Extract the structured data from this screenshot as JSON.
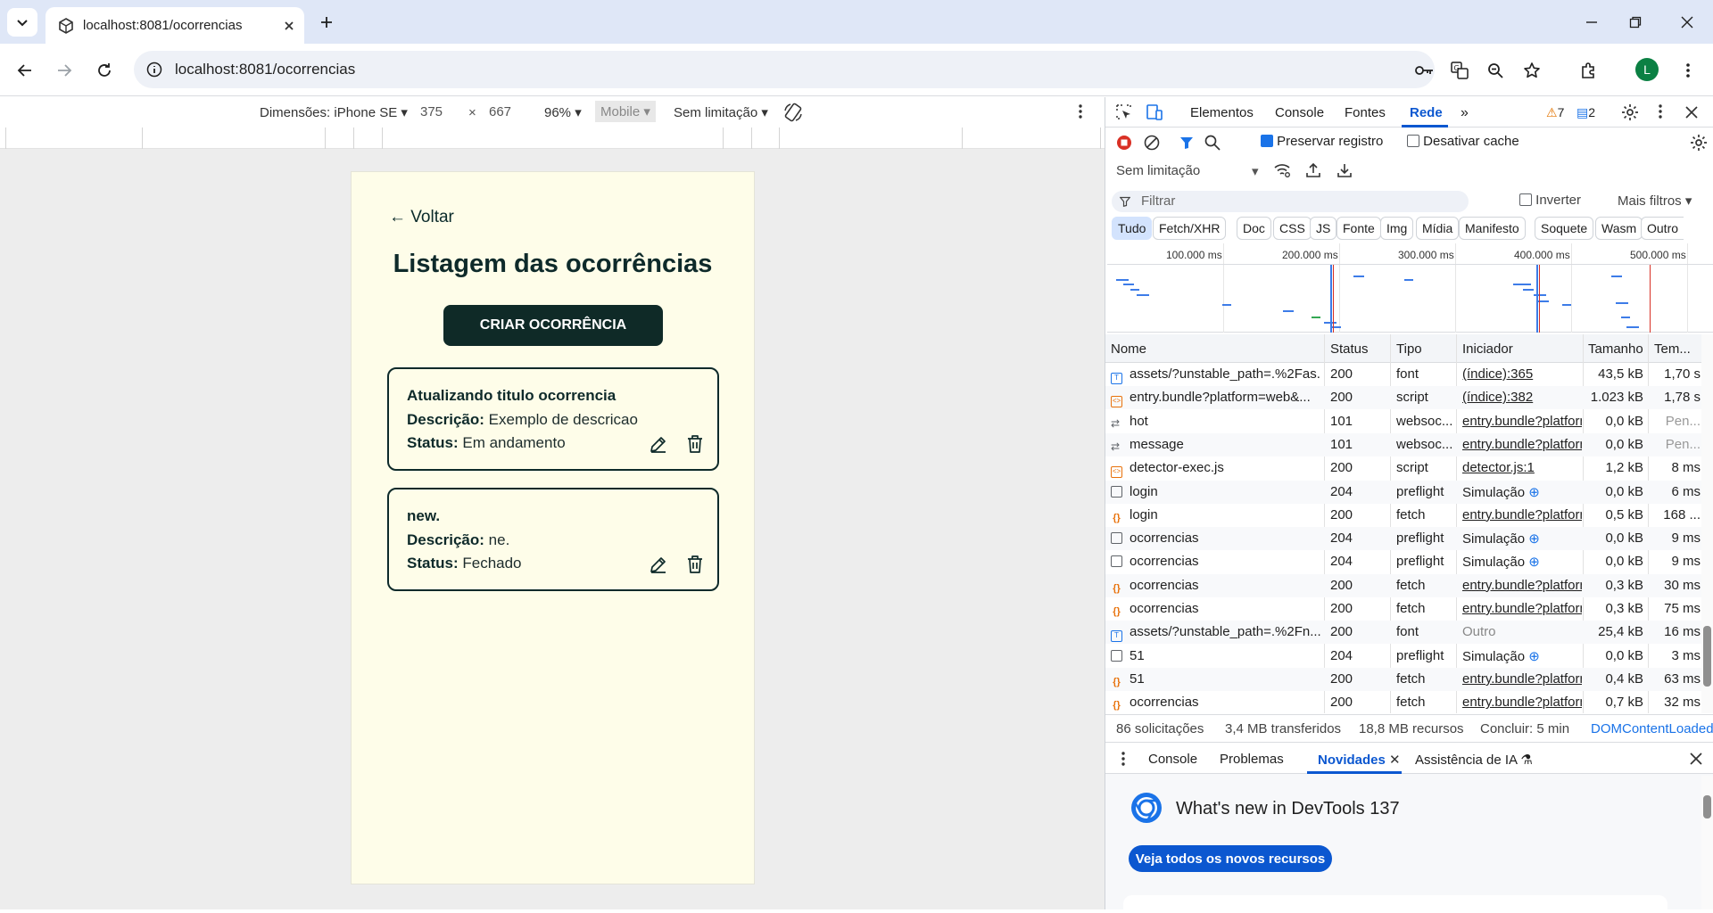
{
  "browser": {
    "tab_title": "localhost:8081/ocorrencias",
    "url": "localhost:8081/ocorrencias",
    "avatar_letter": "L"
  },
  "device_toolbar": {
    "dimensions": "Dimensões: iPhone SE",
    "width": "375",
    "times": "×",
    "height": "667",
    "zoom": "96%",
    "mode": "Mobile",
    "throttle": "Sem limitação"
  },
  "app": {
    "back_label": "← Voltar",
    "title": "Listagem das ocorrências",
    "create_button": "CRIAR OCORRÊNCIA",
    "description_label": "Descrição:",
    "status_label": "Status:",
    "cards": [
      {
        "title": "Atualizando titulo ocorrencia",
        "description": "Exemplo de descricao",
        "status": "Em andamento"
      },
      {
        "title": "new.",
        "description": "ne.",
        "status": "Fechado"
      }
    ]
  },
  "devtools": {
    "tabs": [
      "Elementos",
      "Console",
      "Fontes",
      "Rede"
    ],
    "active_tab": "Rede",
    "warnings": "7",
    "messages": "2",
    "preserve_log": "Preservar registro",
    "disable_cache": "Desativar cache",
    "throttle": "Sem limitação",
    "filter_placeholder": "Filtrar",
    "invert": "Inverter",
    "more_filters": "Mais filtros",
    "type_filters": [
      "Tudo",
      "Fetch/XHR",
      "Doc",
      "CSS",
      "JS",
      "Fonte",
      "Img",
      "Mídia",
      "Manifesto",
      "Soquete",
      "Wasm",
      "Outro"
    ],
    "timeline_labels": [
      "100.000 ms",
      "200.000 ms",
      "300.000 ms",
      "400.000 ms",
      "500.000 ms"
    ],
    "columns": [
      "Nome",
      "Status",
      "Tipo",
      "Iniciador",
      "Tamanho",
      "Tem..."
    ],
    "requests": [
      {
        "name": "assets/?unstable_path=.%2Fas...",
        "status": "200",
        "type": "font",
        "initiator": "(índice):365",
        "size": "43,5 kB",
        "time": "1,70 s",
        "icon": "font"
      },
      {
        "name": "entry.bundle?platform=web&...",
        "status": "200",
        "type": "script",
        "initiator": "(índice):382",
        "size": "1.023 kB",
        "time": "1,78 s",
        "icon": "script"
      },
      {
        "name": "hot",
        "status": "101",
        "type": "websoc...",
        "initiator": "entry.bundle?platform",
        "size": "0,0 kB",
        "time": "Pen...",
        "icon": "ws"
      },
      {
        "name": "message",
        "status": "101",
        "type": "websoc...",
        "initiator": "entry.bundle?platform",
        "size": "0,0 kB",
        "time": "Pen...",
        "icon": "ws"
      },
      {
        "name": "detector-exec.js",
        "status": "200",
        "type": "script",
        "initiator": "detector.js:1",
        "size": "1,2 kB",
        "time": "8 ms",
        "icon": "script"
      },
      {
        "name": "login",
        "status": "204",
        "type": "preflight",
        "initiator": "Simulação",
        "size": "0,0 kB",
        "time": "6 ms",
        "icon": "doc"
      },
      {
        "name": "login",
        "status": "200",
        "type": "fetch",
        "initiator": "entry.bundle?platform",
        "size": "0,5 kB",
        "time": "168 ...",
        "icon": "fetch"
      },
      {
        "name": "ocorrencias",
        "status": "204",
        "type": "preflight",
        "initiator": "Simulação",
        "size": "0,0 kB",
        "time": "9 ms",
        "icon": "doc"
      },
      {
        "name": "ocorrencias",
        "status": "204",
        "type": "preflight",
        "initiator": "Simulação",
        "size": "0,0 kB",
        "time": "9 ms",
        "icon": "doc"
      },
      {
        "name": "ocorrencias",
        "status": "200",
        "type": "fetch",
        "initiator": "entry.bundle?platform",
        "size": "0,3 kB",
        "time": "30 ms",
        "icon": "fetch"
      },
      {
        "name": "ocorrencias",
        "status": "200",
        "type": "fetch",
        "initiator": "entry.bundle?platform",
        "size": "0,3 kB",
        "time": "75 ms",
        "icon": "fetch"
      },
      {
        "name": "assets/?unstable_path=.%2Fn...",
        "status": "200",
        "type": "font",
        "initiator": "Outro",
        "size": "25,4 kB",
        "time": "16 ms",
        "icon": "font"
      },
      {
        "name": "51",
        "status": "204",
        "type": "preflight",
        "initiator": "Simulação",
        "size": "0,0 kB",
        "time": "3 ms",
        "icon": "doc"
      },
      {
        "name": "51",
        "status": "200",
        "type": "fetch",
        "initiator": "entry.bundle?platform",
        "size": "0,4 kB",
        "time": "63 ms",
        "icon": "fetch"
      },
      {
        "name": "ocorrencias",
        "status": "200",
        "type": "fetch",
        "initiator": "entry.bundle?platform",
        "size": "0,7 kB",
        "time": "32 ms",
        "icon": "fetch"
      }
    ],
    "summary": [
      "86 solicitações",
      "3,4 MB transferidos",
      "18,8 MB recursos",
      "Concluir: 5 min",
      "DOMContentLoaded"
    ],
    "drawer_tabs": [
      "Console",
      "Problemas",
      "Novidades",
      "Assistência de IA"
    ],
    "whats_new_title": "What's new in DevTools 137",
    "whats_new_button": "Veja todos os novos recursos"
  },
  "colors": {
    "app_bg": "#fefde9",
    "app_dark": "#0f2a27",
    "devtools_accent": "#1a73e8"
  }
}
